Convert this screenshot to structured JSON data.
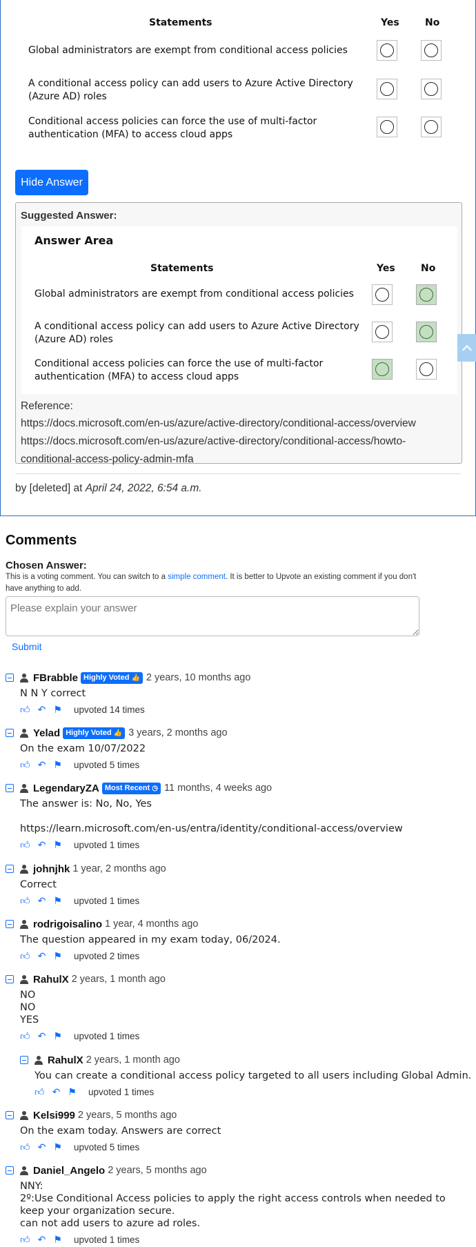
{
  "question": {
    "header": {
      "statements": "Statements",
      "yes": "Yes",
      "no": "No"
    },
    "statements": [
      "Global administrators are exempt from conditional access policies",
      "A conditional access policy can add users to Azure Active Directory (Azure AD) roles",
      "Conditional access policies can force the use of multi-factor authentication (MFA) to access cloud apps"
    ]
  },
  "hide_answer_label": "Hide Answer",
  "suggested": {
    "title": "Suggested Answer:",
    "area_title": "Answer Area",
    "answers": [
      "No",
      "No",
      "Yes"
    ],
    "reference_label": "Reference:",
    "references": [
      "https://docs.microsoft.com/en-us/azure/active-directory/conditional-access/overview",
      "https://docs.microsoft.com/en-us/azure/active-directory/conditional-access/howto-conditional-access-policy-admin-mfa"
    ],
    "selected_color": "#c5dfc2"
  },
  "byline": {
    "prefix": "by [deleted] at",
    "date": "April 24, 2022, 6:54 a.m."
  },
  "comments_section": {
    "title": "Comments",
    "chosen_answer_label": "Chosen Answer:",
    "vote_note_before": "This is a voting comment. You can switch to a ",
    "vote_note_link": "simple comment",
    "vote_note_after": ". It is better to Upvote an existing comment if you don't have anything to add.",
    "explain_placeholder": "Please explain your answer",
    "submit_label": "Submit"
  },
  "comments": [
    {
      "user": "FBrabble",
      "badge": "Highly Voted",
      "badge_icon": "thumbs-up-icon",
      "time": "2 years, 10 months ago",
      "body": "N N Y correct",
      "upvotes": "upvoted 14 times"
    },
    {
      "user": "Yelad",
      "badge": "Highly Voted",
      "badge_icon": "thumbs-up-icon",
      "time": "3 years, 2 months ago",
      "body": "On the exam 10/07/2022",
      "upvotes": "upvoted 5 times"
    },
    {
      "user": "LegendaryZA",
      "badge": "Most Recent",
      "badge_icon": "clock-icon",
      "time": "11 months, 4 weeks ago",
      "body": "The answer is: No, No, Yes\n\nhttps://learn.microsoft.com/en-us/entra/identity/conditional-access/overview",
      "upvotes": "upvoted 1 times"
    },
    {
      "user": "johnjhk",
      "badge": "",
      "time": "1 year, 2 months ago",
      "body": "Correct",
      "upvotes": "upvoted 1 times"
    },
    {
      "user": "rodrigoisalino",
      "badge": "",
      "time": "1 year, 4 months ago",
      "body": "The question appeared in my exam today, 06/2024.",
      "upvotes": "upvoted 2 times"
    },
    {
      "user": "RahulX",
      "badge": "",
      "time": "2 years, 1 month ago",
      "body": "NO\nNO\nYES",
      "upvotes": "upvoted 1 times"
    },
    {
      "user": "RahulX",
      "badge": "",
      "time": "2 years, 1 month ago",
      "body": "You can create a conditional access policy targeted to all users including Global Admin.",
      "upvotes": "upvoted 1 times",
      "reply": true
    },
    {
      "user": "Kelsi999",
      "badge": "",
      "time": "2 years, 5 months ago",
      "body": "On the exam today. Answers are correct",
      "upvotes": "upvoted 5 times"
    },
    {
      "user": "Daniel_Angelo",
      "badge": "",
      "time": "2 years, 5 months ago",
      "body": "NNY:\n2º:Use Conditional Access policies to apply the right access controls when needed to keep your organization secure.\ncan not add users to azure ad roles.",
      "upvotes": "upvoted 1 times"
    }
  ]
}
